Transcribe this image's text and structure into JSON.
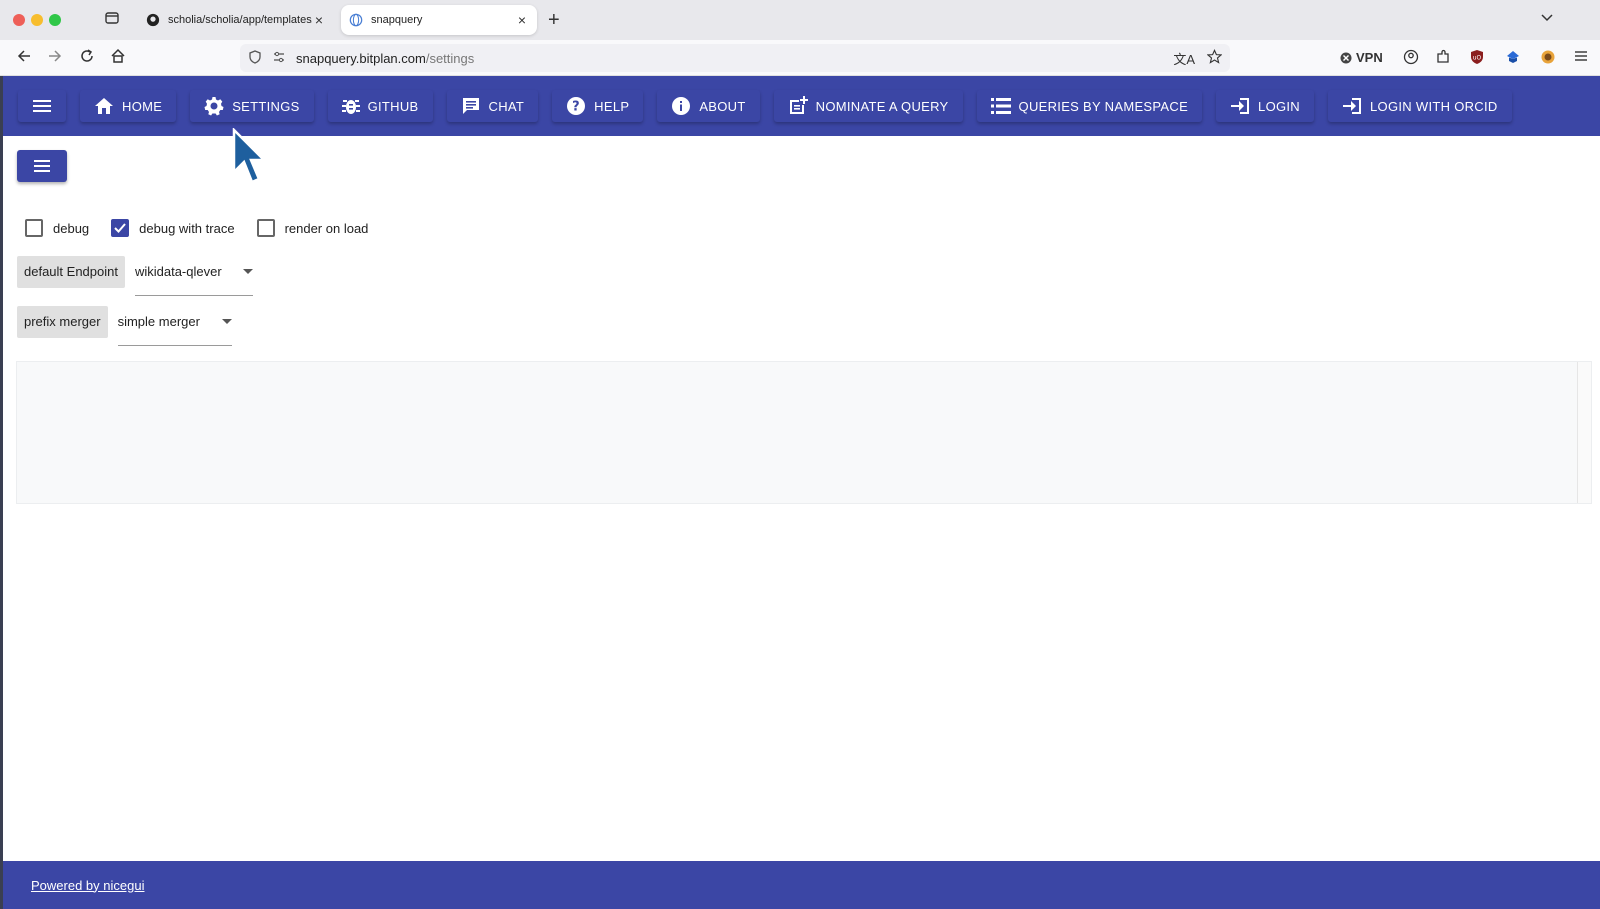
{
  "browser": {
    "tabs": [
      {
        "title": "scholia/scholia/app/templates/a",
        "active": false
      },
      {
        "title": "snapquery",
        "active": true
      }
    ],
    "url_domain": "snapquery.bitplan.com",
    "url_path": "/settings",
    "vpn_label": "VPN"
  },
  "header": {
    "items": [
      {
        "label": "HOME",
        "icon": "home-icon"
      },
      {
        "label": "SETTINGS",
        "icon": "gear-icon"
      },
      {
        "label": "GITHUB",
        "icon": "bug-icon"
      },
      {
        "label": "CHAT",
        "icon": "chat-icon"
      },
      {
        "label": "HELP",
        "icon": "help-icon"
      },
      {
        "label": "ABOUT",
        "icon": "info-icon"
      },
      {
        "label": "NOMINATE A QUERY",
        "icon": "post-add-icon"
      },
      {
        "label": "QUERIES BY NAMESPACE",
        "icon": "list-icon"
      },
      {
        "label": "LOGIN",
        "icon": "login-icon"
      },
      {
        "label": "LOGIN WITH ORCID",
        "icon": "login-icon"
      }
    ]
  },
  "settings": {
    "checkboxes": [
      {
        "label": "debug",
        "checked": false
      },
      {
        "label": "debug with trace",
        "checked": true
      },
      {
        "label": "render on load",
        "checked": false
      }
    ],
    "endpoint_label": "default Endpoint",
    "endpoint_value": "wikidata-qlever",
    "merger_label": "prefix merger",
    "merger_value": "simple merger"
  },
  "footer": {
    "link_text": "Powered by nicegui"
  },
  "colors": {
    "primary": "#3b46a5"
  }
}
